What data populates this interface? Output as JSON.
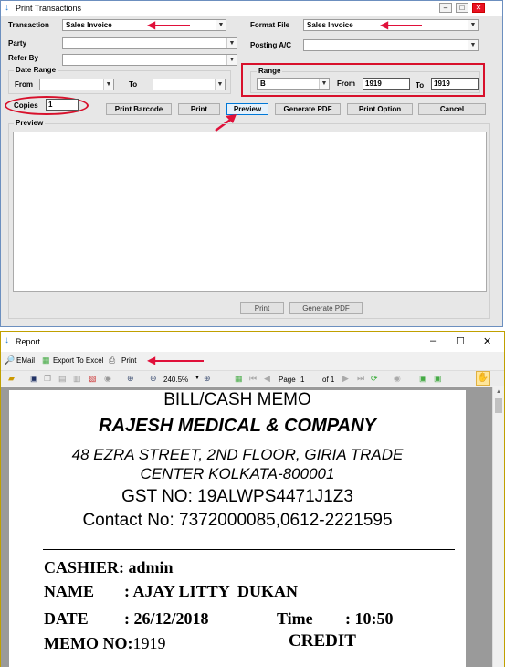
{
  "print_window": {
    "title": "Print Transactions",
    "transaction": {
      "label": "Transaction",
      "value": "Sales Invoice"
    },
    "format_file": {
      "label": "Format File",
      "value": "Sales Invoice"
    },
    "party": {
      "label": "Party",
      "value": ""
    },
    "posting": {
      "label": "Posting A/C",
      "value": ""
    },
    "refer_by": {
      "label": "Refer By",
      "value": ""
    },
    "date_range": {
      "label": "Date Range",
      "from_label": "From",
      "to_label": "To",
      "from_value": "",
      "to_value": ""
    },
    "range": {
      "label": "Range",
      "value": "B",
      "from_label": "From",
      "from_value": "1919",
      "to_label": "To",
      "to_value": "1919"
    },
    "copies": {
      "label": "Copies",
      "value": "1"
    },
    "buttons": {
      "print_barcode": "Print Barcode",
      "print": "Print",
      "preview": "Preview",
      "generate_pdf": "Generate PDF",
      "print_option": "Print Option",
      "cancel": "Cancel"
    },
    "preview_label": "Preview",
    "bottom_buttons": {
      "print": "Print",
      "generate_pdf": "Generate PDF"
    }
  },
  "report_window": {
    "title": "Report",
    "menu": {
      "email": "EMail",
      "export": "Export To Excel",
      "print": "Print"
    },
    "toolbar": {
      "zoom": "240.5%",
      "page_label": "Page",
      "page_value": "1",
      "of_label": "of 1"
    },
    "memo": {
      "heading": "BILL/CASH MEMO",
      "company": "RAJESH MEDICAL & COMPANY",
      "address1": "48 EZRA STREET, 2ND FLOOR, GIRIA TRADE",
      "address2": "CENTER KOLKATA-800001",
      "gst": "GST NO: 19ALWPS4471J1Z3",
      "contact": "Contact No: 7372000085,0612-2221595",
      "cashier": "CASHIER: admin",
      "name_label": "NAME",
      "name_value": ": AJAY LITTY  DUKAN",
      "date_label": "DATE",
      "date_value": ": 26/12/2018",
      "time_label": "Time",
      "time_value": ": 10:50",
      "memo_label": "MEMO NO:",
      "memo_value": "1919",
      "credit": "CREDIT"
    }
  }
}
